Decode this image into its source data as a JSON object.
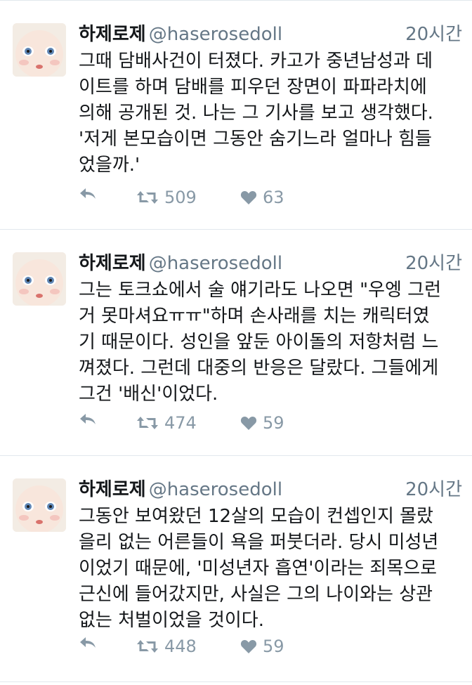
{
  "colors": {
    "name": "#14171a",
    "secondary": "#657786",
    "action_icon": "#8899a6",
    "divider": "#e1e8ed"
  },
  "tweets": [
    {
      "name": "하제로제",
      "handle": "@haserosedoll",
      "time": "20시간",
      "lines": [
        "그때 담배사건이 터졌다. 카고가 중년남성과 데",
        "이트를 하며 담배를 피우던 장면이 파파라치에",
        "의해 공개된 것. 나는 그 기사를 보고 생각했다.",
        "'저게 본모습이면 그동안 숨기느라 얼마나 힘들",
        "었을까.'"
      ],
      "retweets": "509",
      "likes": "63"
    },
    {
      "name": "하제로제",
      "handle": "@haserosedoll",
      "time": "20시간",
      "lines": [
        "그는 토크쇼에서 술 얘기라도 나오면 \"우엥 그런",
        "거 못마셔요ㅠㅠ\"하며 손사래를 치는 캐릭터였",
        "기 때문이다. 성인을 앞둔 아이돌의 저항처럼 느",
        "껴졌다. 그런데 대중의 반응은 달랐다. 그들에게",
        "그건 '배신'이었다."
      ],
      "retweets": "474",
      "likes": "59"
    },
    {
      "name": "하제로제",
      "handle": "@haserosedoll",
      "time": "20시간",
      "lines": [
        "그동안 보여왔던 12살의 모습이 컨셉인지 몰랐",
        "을리 없는 어른들이 욕을 퍼붓더라. 당시 미성년",
        "이었기 때문에, '미성년자 흡연'이라는 죄목으로",
        "근신에 들어갔지만, 사실은 그의 나이와는 상관",
        "없는 처벌이었을 것이다."
      ],
      "retweets": "448",
      "likes": "59"
    }
  ],
  "icons": {
    "avatar": "doll-face-avatar",
    "reply": "reply-icon",
    "retweet": "retweet-icon",
    "like": "heart-icon"
  }
}
